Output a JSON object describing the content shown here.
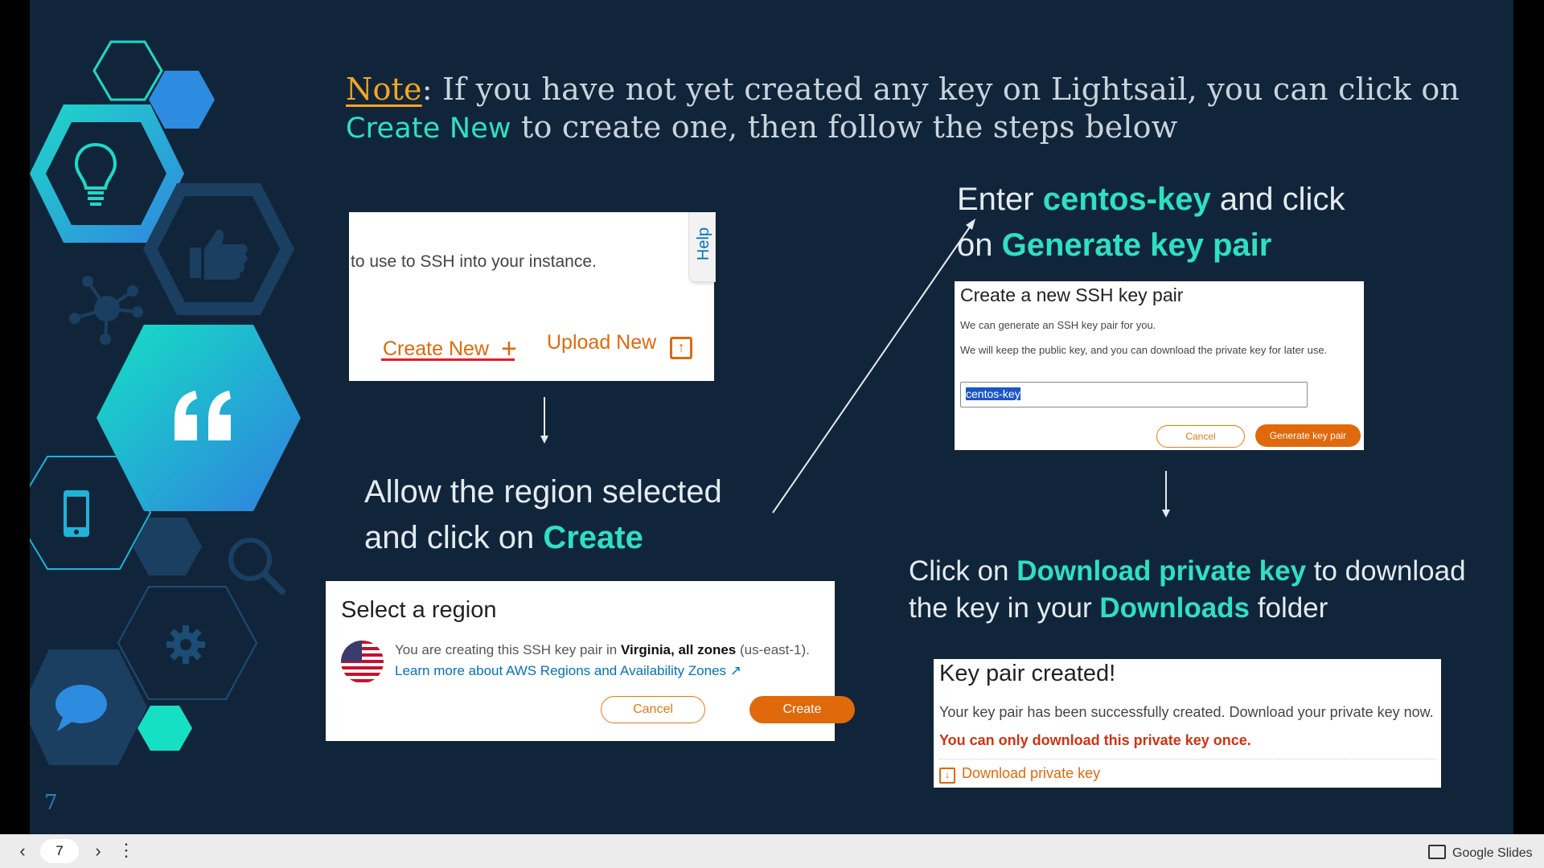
{
  "slide": {
    "page_number": "7",
    "note": {
      "label": "Note",
      "text_1": ": If you have not yet created any key on Lightsail, you can click on ",
      "highlight": "Create New",
      "text_2": " to create one, then follow the steps below"
    },
    "step_region": {
      "line_1": "Allow the region selected",
      "line_2_prefix": "and click on ",
      "line_2_highlight": "Create"
    },
    "step_key": {
      "prefix_1": "Enter ",
      "highlight_1": "centos-key",
      "suffix_1": " and click",
      "prefix_2": "on ",
      "highlight_2": "Generate key pair"
    },
    "step_download": {
      "prefix_1": "Click on ",
      "highlight_1": "Download private key",
      "suffix_1": " to download",
      "prefix_2": "the key in your ",
      "highlight_2": "Downloads",
      "suffix_2": " folder"
    }
  },
  "create_new_shot": {
    "ssh_text": "to use to SSH into your instance.",
    "create_new": "Create New",
    "upload_new": "Upload New",
    "help_tab": "Help"
  },
  "region_shot": {
    "title": "Select a region",
    "desc_prefix": "You are creating this SSH key pair in ",
    "desc_bold": "Virginia, all zones",
    "desc_suffix": " (us-east-1).",
    "learn_more": "Learn more about AWS Regions and Availability Zones",
    "cancel": "Cancel",
    "create": "Create"
  },
  "keypair_shot": {
    "title": "Create a new SSH key pair",
    "line_1": "We can generate an SSH key pair for you.",
    "line_2": "We will keep the public key, and you can download the private key for later use.",
    "input_value": "centos-key",
    "cancel": "Cancel",
    "generate": "Generate key pair"
  },
  "created_shot": {
    "title": "Key pair created!",
    "line_1": "Your key pair has been successfully created. Download your private key now.",
    "warning": "You can only download this private key once.",
    "download": "Download private key"
  },
  "bottom_bar": {
    "page_input": "7",
    "app_label": "Google Slides"
  },
  "colors": {
    "slide_bg": "#11253a",
    "highlight": "#2ee0c2",
    "note_label": "#f4a623",
    "aws_orange": "#e0690c",
    "warning_red": "#d13212",
    "link_blue": "#0073bb"
  }
}
